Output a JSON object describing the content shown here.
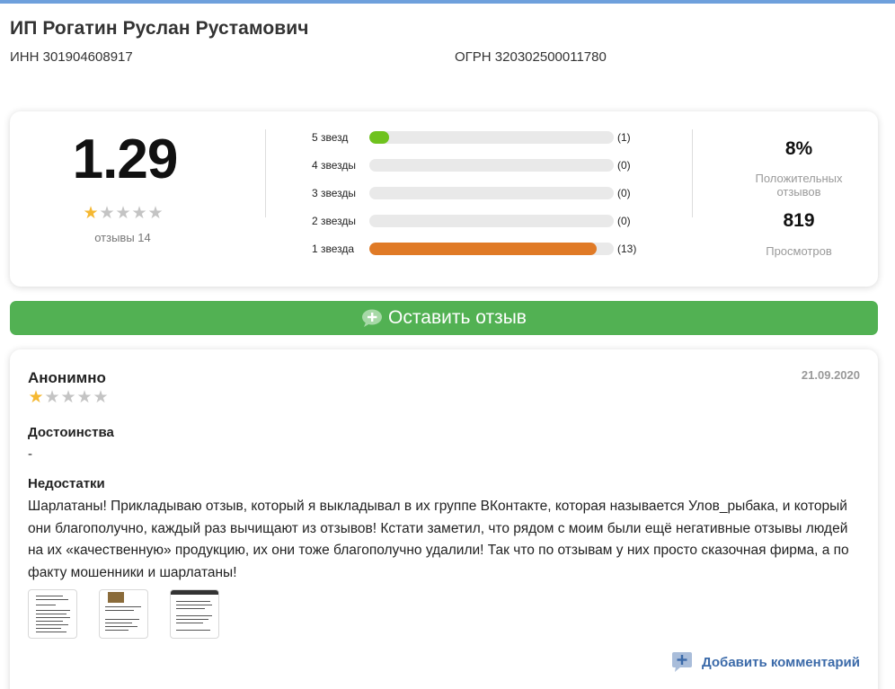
{
  "company": {
    "name": "ИП Рогатин Руслан Рустамович",
    "inn": "ИНН 301904608917",
    "ogrn": "ОГРН 320302500011780"
  },
  "summary": {
    "score": "1.29",
    "stars_filled": 1,
    "stars_total": 5,
    "reviews_label": "отзывы 14",
    "positive_pct": "8%",
    "positive_label": "Положительных отзывов",
    "views": "819",
    "views_label": "Просмотров"
  },
  "distribution": [
    {
      "label": "5 звезд",
      "count": 1,
      "count_label": "(1)",
      "fraction": 0.08,
      "color": "#6fc21e"
    },
    {
      "label": "4 звезды",
      "count": 0,
      "count_label": "(0)",
      "fraction": 0,
      "color": "#6fc21e"
    },
    {
      "label": "3 звезды",
      "count": 0,
      "count_label": "(0)",
      "fraction": 0,
      "color": "#6fc21e"
    },
    {
      "label": "2 звезды",
      "count": 0,
      "count_label": "(0)",
      "fraction": 0,
      "color": "#6fc21e"
    },
    {
      "label": "1 звезда",
      "count": 13,
      "count_label": "(13)",
      "fraction": 0.93,
      "color": "#e07a26"
    }
  ],
  "leave_review": {
    "label": "Оставить отзыв",
    "icon": "plus-bubble-icon",
    "color": "#52b153"
  },
  "review": {
    "author": "Анонимно",
    "date": "21.09.2020",
    "stars_filled": 1,
    "pros_title": "Достоинства",
    "pros_text": "-",
    "cons_title": "Недостатки",
    "cons_text": "Шарлатаны! Прикладываю отзыв, который я выкладывал в их группе ВКонтакте, которая называется Улов_рыбака, и который они благополучно, каждый раз вычищают из отзывов! Кстати заметил, что рядом с моим были ещё негативные отзывы людей на их «качественную» продукцию, их они тоже благополучно удалили! Так что по отзывам у них просто сказочная фирма, а по факту мошенники и шарлатаны!",
    "attachments_count": 3,
    "add_comment_label": "Добавить комментарий"
  },
  "colors": {
    "accent_link": "#3b6aa9",
    "star_on": "#f5b832",
    "star_off": "#c4c4c4"
  }
}
